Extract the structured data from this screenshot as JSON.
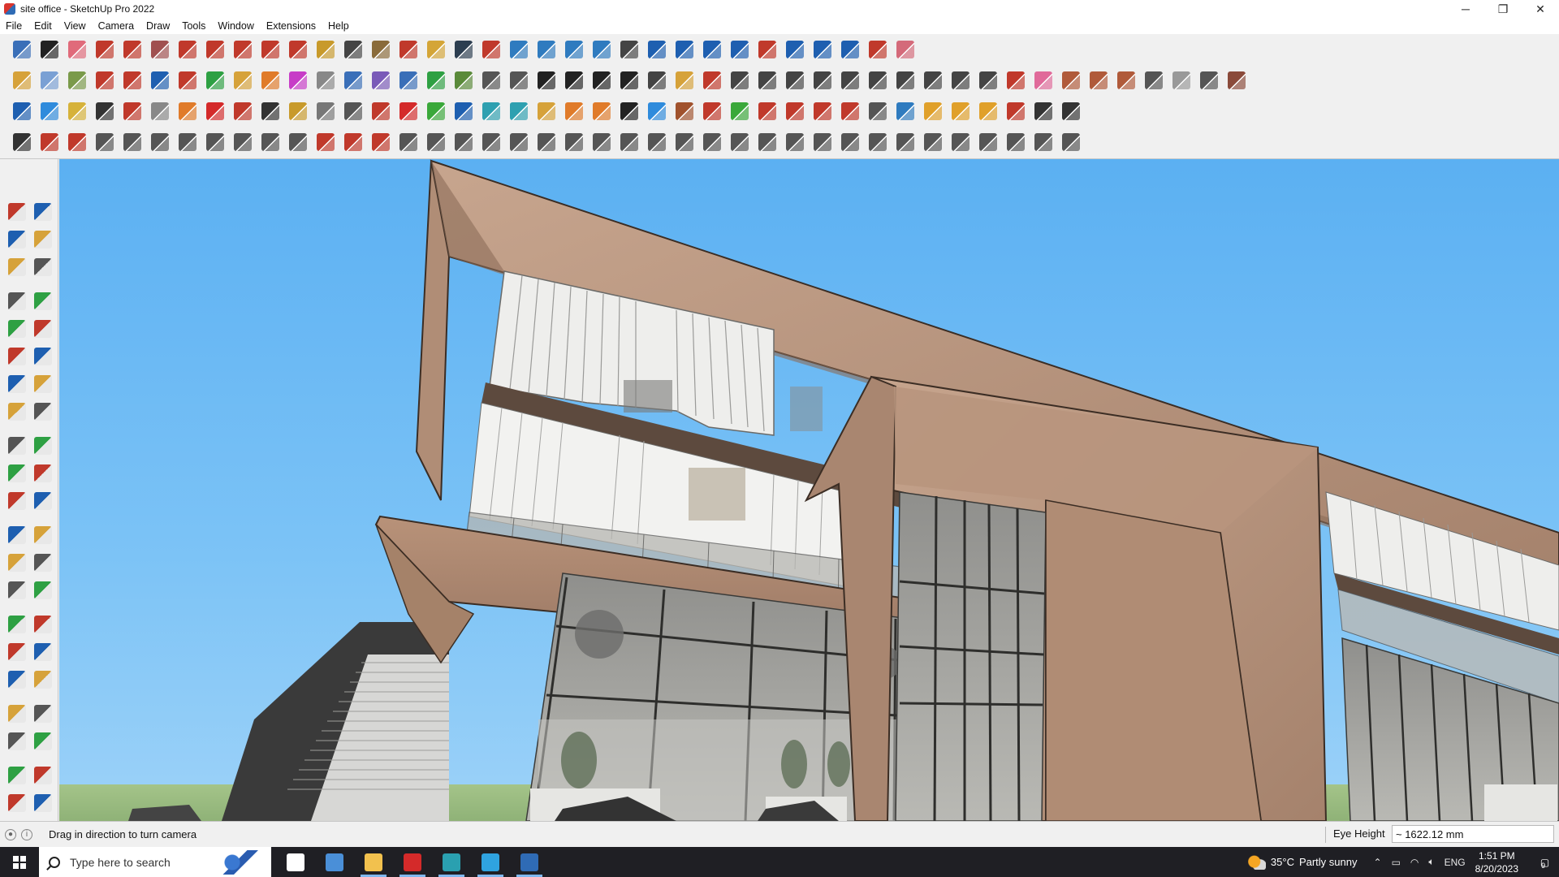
{
  "window": {
    "title": "site office - SketchUp Pro 2022",
    "controls": {
      "minimize": "─",
      "restore": "❐",
      "close": "✕"
    }
  },
  "menu": [
    "File",
    "Edit",
    "View",
    "Camera",
    "Draw",
    "Tools",
    "Window",
    "Extensions",
    "Help"
  ],
  "toolbars": {
    "row1": [
      {
        "icon": "zoom-extents-icon",
        "color": "#3a6fb8"
      },
      {
        "icon": "select-icon",
        "color": "#222222"
      },
      {
        "icon": "eraser-icon",
        "color": "#e06a7a"
      },
      {
        "icon": "pencil-icon",
        "color": "#c0392b"
      },
      {
        "icon": "freehand-icon",
        "color": "#c0392b"
      },
      {
        "icon": "rectangle-icon",
        "color": "#a05050"
      },
      {
        "icon": "push-pull-icon",
        "color": "#c0392b"
      },
      {
        "icon": "follow-me-icon",
        "color": "#c0392b"
      },
      {
        "icon": "move-icon",
        "color": "#c0392b"
      },
      {
        "icon": "rotate-icon",
        "color": "#c0392b"
      },
      {
        "icon": "scale-icon",
        "color": "#c0392b"
      },
      {
        "icon": "tape-measure-icon",
        "color": "#c89a2b"
      },
      {
        "icon": "text-icon",
        "color": "#444444"
      },
      {
        "icon": "paint-bucket-icon",
        "color": "#8a6b3a"
      },
      {
        "icon": "orbit-icon",
        "color": "#c0392b"
      },
      {
        "icon": "pan-icon",
        "color": "#d4a537"
      },
      {
        "icon": "zoom-icon",
        "color": "#2c3e50"
      },
      {
        "icon": "zoom-window-icon",
        "color": "#c0392b"
      },
      {
        "icon": "section-plane-icon",
        "color": "#2f7bbf"
      },
      {
        "icon": "section-display-icon",
        "color": "#2f7bbf"
      },
      {
        "icon": "layers-icon",
        "color": "#2f7bbf"
      },
      {
        "icon": "sandbox-icon",
        "color": "#2f7bbf"
      },
      {
        "icon": "user-account-icon",
        "color": "#444444"
      },
      {
        "icon": "solid-tools-icon",
        "color": "#1e5fb0"
      },
      {
        "icon": "outer-shell-icon",
        "color": "#1e5fb0"
      },
      {
        "icon": "intersect-icon",
        "color": "#1e5fb0"
      },
      {
        "icon": "flip-icon",
        "color": "#1e5fb0"
      },
      {
        "icon": "flip-z-icon",
        "color": "#c0392b"
      },
      {
        "icon": "measure-icon",
        "color": "#1e5fb0"
      },
      {
        "icon": "warehouse-icon",
        "color": "#1e5fb0"
      },
      {
        "icon": "undo-icon",
        "color": "#1e5fb0"
      },
      {
        "icon": "redo-icon",
        "color": "#c0392b"
      },
      {
        "icon": "extension-icon",
        "color": "#d46a7a"
      }
    ],
    "row2": [
      {
        "icon": "component-icon",
        "color": "#d6a23a"
      },
      {
        "icon": "group-icon",
        "color": "#7aa0d4"
      },
      {
        "icon": "sphere-icon",
        "color": "#7a9a4a"
      },
      {
        "icon": "move-red-icon",
        "color": "#c0392b"
      },
      {
        "icon": "push-up-icon",
        "color": "#c0392b"
      },
      {
        "icon": "push-down-icon",
        "color": "#1e5fb0"
      },
      {
        "icon": "push-r-icon",
        "color": "#c0392b"
      },
      {
        "icon": "push-v-icon",
        "color": "#2ea043"
      },
      {
        "icon": "push-n-icon",
        "color": "#d6a23a"
      },
      {
        "icon": "push-x-icon",
        "color": "#e07b2a"
      },
      {
        "icon": "push-f-icon",
        "color": "#c73cc7"
      },
      {
        "icon": "curve-icon",
        "color": "#888888"
      },
      {
        "icon": "face-1-icon",
        "color": "#3a6fb8"
      },
      {
        "icon": "face-2-icon",
        "color": "#7a5ab8"
      },
      {
        "icon": "face-3-icon",
        "color": "#3a6fb8"
      },
      {
        "icon": "plane-green-icon",
        "color": "#2ea043"
      },
      {
        "icon": "plane-solid-icon",
        "color": "#5a8a3a"
      },
      {
        "icon": "box-open-icon",
        "color": "#555555"
      },
      {
        "icon": "book-icon",
        "color": "#555555"
      },
      {
        "icon": "house-icon",
        "color": "#222222"
      },
      {
        "icon": "house-2-icon",
        "color": "#222222"
      },
      {
        "icon": "house-3-icon",
        "color": "#222222"
      },
      {
        "icon": "house-4-icon",
        "color": "#222222"
      },
      {
        "icon": "fx-icon",
        "color": "#444444"
      },
      {
        "icon": "leaf-icon",
        "color": "#d6a23a"
      },
      {
        "icon": "knife-icon",
        "color": "#c0392b"
      },
      {
        "icon": "shape-1-icon",
        "color": "#444444"
      },
      {
        "icon": "shape-2-icon",
        "color": "#444444"
      },
      {
        "icon": "shape-3-icon",
        "color": "#444444"
      },
      {
        "icon": "shape-4-icon",
        "color": "#444444"
      },
      {
        "icon": "shape-5-icon",
        "color": "#444444"
      },
      {
        "icon": "shape-6-icon",
        "color": "#444444"
      },
      {
        "icon": "shape-7-icon",
        "color": "#444444"
      },
      {
        "icon": "shape-8-icon",
        "color": "#444444"
      },
      {
        "icon": "shape-9-icon",
        "color": "#444444"
      },
      {
        "icon": "shape-10-icon",
        "color": "#444444"
      },
      {
        "icon": "pencil-red-icon",
        "color": "#c0392b"
      },
      {
        "icon": "eraser-pink-icon",
        "color": "#e06a9a"
      },
      {
        "icon": "texture-1-icon",
        "color": "#b05a3a"
      },
      {
        "icon": "texture-2-icon",
        "color": "#b05a3a"
      },
      {
        "icon": "texture-3-icon",
        "color": "#b05a3a"
      },
      {
        "icon": "texture-4-icon",
        "color": "#555555"
      },
      {
        "icon": "texture-5-icon",
        "color": "#999999"
      },
      {
        "icon": "texture-6-icon",
        "color": "#555555"
      },
      {
        "icon": "texture-7-icon",
        "color": "#8a4a3a"
      }
    ],
    "row3": [
      {
        "icon": "plane-blue-icon",
        "color": "#1e5fb0"
      },
      {
        "icon": "plane-blue-2-icon",
        "color": "#2f8bdc"
      },
      {
        "icon": "plane-yellow-icon",
        "color": "#d6b23a"
      },
      {
        "icon": "text-tag-icon",
        "color": "#333333"
      },
      {
        "icon": "ruby-icon",
        "color": "#c0392b"
      },
      {
        "icon": "plane-grey-icon",
        "color": "#888888"
      },
      {
        "icon": "rotate-orange-icon",
        "color": "#e07b2a"
      },
      {
        "icon": "red-square-icon",
        "color": "#d42a2a"
      },
      {
        "icon": "layer-stack-icon",
        "color": "#c0392b"
      },
      {
        "icon": "sheet-icon",
        "color": "#333333"
      },
      {
        "icon": "brush-icon",
        "color": "#c89a2b"
      },
      {
        "icon": "link-icon",
        "color": "#777777"
      },
      {
        "icon": "arc-icon",
        "color": "#555555"
      },
      {
        "icon": "dotted-curve-icon",
        "color": "#c0392b"
      },
      {
        "icon": "plus-red-icon",
        "color": "#d42a2a"
      },
      {
        "icon": "plus-green-icon",
        "color": "#3aa83a"
      },
      {
        "icon": "x-blue-icon",
        "color": "#1e5fb0"
      },
      {
        "icon": "cone-icon",
        "color": "#2ea0b0"
      },
      {
        "icon": "cone-2-icon",
        "color": "#2ea0b0"
      },
      {
        "icon": "triangle-icon",
        "color": "#d6a23a"
      },
      {
        "icon": "lasso-icon",
        "color": "#e07b2a"
      },
      {
        "icon": "lasso-2-icon",
        "color": "#e07b2a"
      },
      {
        "icon": "lasso-3-icon",
        "color": "#222222"
      },
      {
        "icon": "crosshair-icon",
        "color": "#2f8bdc"
      },
      {
        "icon": "box-brown-icon",
        "color": "#a0522d"
      },
      {
        "icon": "hook-icon",
        "color": "#c0392b"
      },
      {
        "icon": "tree-icon",
        "color": "#3aa83a"
      },
      {
        "icon": "cube-red-icon",
        "color": "#c0392b"
      },
      {
        "icon": "cube-red-2-icon",
        "color": "#c0392b"
      },
      {
        "icon": "cube-red-3-icon",
        "color": "#c0392b"
      },
      {
        "icon": "gem-red-icon",
        "color": "#c0392b"
      },
      {
        "icon": "grid-tool-icon",
        "color": "#555555"
      },
      {
        "icon": "frame-tool-icon",
        "color": "#2f7bbf"
      },
      {
        "icon": "tile-orange-icon",
        "color": "#e0a02a"
      },
      {
        "icon": "tile-orange-2-icon",
        "color": "#e0a02a"
      },
      {
        "icon": "tile-orange-3-icon",
        "color": "#e0a02a"
      },
      {
        "icon": "scatter-icon",
        "color": "#c0392b"
      },
      {
        "icon": "dots-curve-icon",
        "color": "#333333"
      },
      {
        "icon": "blocks-icon",
        "color": "#333333"
      }
    ],
    "row4": [
      {
        "icon": "line-tool-icon",
        "color": "#333333"
      },
      {
        "icon": "bezier-icon",
        "color": "#c0392b"
      },
      {
        "icon": "fill-red-icon",
        "color": "#c0392b"
      },
      {
        "icon": "wire-1-icon",
        "color": "#555555"
      },
      {
        "icon": "wire-2-icon",
        "color": "#555555"
      },
      {
        "icon": "wire-3-icon",
        "color": "#555555"
      },
      {
        "icon": "wire-4-icon",
        "color": "#555555"
      },
      {
        "icon": "wire-5-icon",
        "color": "#555555"
      },
      {
        "icon": "wire-6-icon",
        "color": "#555555"
      },
      {
        "icon": "wire-7-icon",
        "color": "#555555"
      },
      {
        "icon": "corner-icon",
        "color": "#555555"
      },
      {
        "icon": "corner-2-icon",
        "color": "#c0392b"
      },
      {
        "icon": "line-red-icon",
        "color": "#c0392b"
      },
      {
        "icon": "bend-icon",
        "color": "#c0392b"
      },
      {
        "icon": "frame-box-icon",
        "color": "#555555"
      },
      {
        "icon": "tent-icon",
        "color": "#555555"
      },
      {
        "icon": "fence-icon",
        "color": "#555555"
      },
      {
        "icon": "fence-2-icon",
        "color": "#555555"
      },
      {
        "icon": "coil-icon",
        "color": "#555555"
      },
      {
        "icon": "wedge-icon",
        "color": "#555555"
      },
      {
        "icon": "arrow-tool-icon",
        "color": "#555555"
      },
      {
        "icon": "stairs-icon",
        "color": "#555555"
      },
      {
        "icon": "ramp-icon",
        "color": "#555555"
      },
      {
        "icon": "rails-icon",
        "color": "#555555"
      },
      {
        "icon": "rails-2-icon",
        "color": "#555555"
      },
      {
        "icon": "rails-3-icon",
        "color": "#555555"
      },
      {
        "icon": "truss-icon",
        "color": "#555555"
      },
      {
        "icon": "stair-2-icon",
        "color": "#555555"
      },
      {
        "icon": "stair-3-icon",
        "color": "#555555"
      },
      {
        "icon": "stair-4-icon",
        "color": "#555555"
      },
      {
        "icon": "stair-5-icon",
        "color": "#555555"
      },
      {
        "icon": "hatch-icon",
        "color": "#555555"
      },
      {
        "icon": "hatch-2-icon",
        "color": "#555555"
      },
      {
        "icon": "bars-icon",
        "color": "#555555"
      },
      {
        "icon": "dome-icon",
        "color": "#555555"
      },
      {
        "icon": "spiral-icon",
        "color": "#555555"
      },
      {
        "icon": "slope-icon",
        "color": "#555555"
      },
      {
        "icon": "grass-icon",
        "color": "#555555"
      },
      {
        "icon": "house-outline-icon",
        "color": "#555555"
      }
    ],
    "left": [
      [
        "select-icon",
        "orbit-icon"
      ],
      [
        "paint-bucket-icon",
        "eraser-icon"
      ],
      [
        "component-icon",
        "tape-measure-icon"
      ],
      [
        "line-icon",
        "freehand-icon"
      ],
      [
        "rectangle-icon",
        "rotated-rectangle-icon"
      ],
      [
        "circle-icon",
        "polygon-icon"
      ],
      [
        "arc-icon",
        "two-point-arc-icon"
      ],
      [
        "three-point-arc-icon",
        "pie-icon"
      ],
      [
        "move-icon",
        "push-pull-icon"
      ],
      [
        "rotate-icon",
        "follow-me-icon"
      ],
      [
        "scale-icon",
        "offset-icon"
      ],
      [
        "tape-measure-icon",
        "dimension-icon"
      ],
      [
        "protractor-icon",
        "text-icon"
      ],
      [
        "axes-icon",
        "3d-text-icon"
      ],
      [
        "orbit-icon",
        "pan-icon"
      ],
      [
        "zoom-icon",
        "zoom-window-icon"
      ],
      [
        "zoom-extents-icon",
        "previous-view-icon"
      ],
      [
        "position-camera-icon",
        "look-around-icon"
      ],
      [
        "walk-icon",
        "section-plane-icon"
      ],
      [
        "section-display-icon",
        "section-cut-icon"
      ],
      [
        "layers-icon",
        "sandbox-icon"
      ]
    ]
  },
  "status": {
    "message": "Drag in direction to turn camera",
    "measurement_label": "Eye Height",
    "measurement_value": "~ 1622.12 mm"
  },
  "taskbar": {
    "search_placeholder": "Type here to search",
    "weather_temp": "35°C",
    "weather_text": "Partly sunny",
    "language": "ENG",
    "time": "1:51 PM",
    "date": "8/20/2023",
    "notification_count": "9",
    "apps": [
      {
        "icon": "task-view-icon",
        "color": "#ffffff"
      },
      {
        "icon": "calculator-icon",
        "color": "#4a8fd8"
      },
      {
        "icon": "file-explorer-icon",
        "color": "#f2c14e"
      },
      {
        "icon": "acrobat-icon",
        "color": "#d42a2a"
      },
      {
        "icon": "3dsmax-icon",
        "color": "#2aa0b0"
      },
      {
        "icon": "edge-icon",
        "color": "#2fa3e0"
      },
      {
        "icon": "sketchup-icon",
        "color": "#2f6bb5"
      }
    ]
  }
}
